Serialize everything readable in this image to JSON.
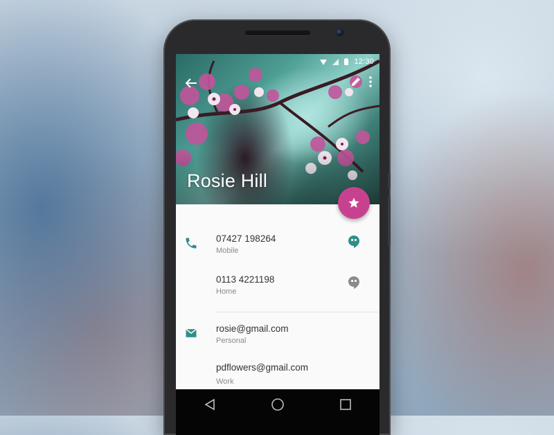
{
  "status_bar": {
    "time": "12:30",
    "icons": [
      "wifi-icon",
      "signal-icon",
      "battery-icon"
    ]
  },
  "contact": {
    "name": "Rosie Hill"
  },
  "header_actions": [
    "back-arrow-icon",
    "edit-icon",
    "more-vert-icon"
  ],
  "fab": {
    "icon": "star-icon",
    "color": "#c8418f"
  },
  "phones": [
    {
      "number": "07427 198264",
      "type": "Mobile",
      "hangout_color": "#2f8f8a"
    },
    {
      "number": "0113 4221198",
      "type": "Home",
      "hangout_color": "#8a8a8a"
    }
  ],
  "emails": [
    {
      "address": "rosie@gmail.com",
      "type": "Personal"
    },
    {
      "address": "pdflowers@gmail.com",
      "type": "Work"
    }
  ],
  "accent_color": "#2f8f8a",
  "nav": [
    "back-triangle-icon",
    "home-circle-icon",
    "recents-square-icon"
  ]
}
